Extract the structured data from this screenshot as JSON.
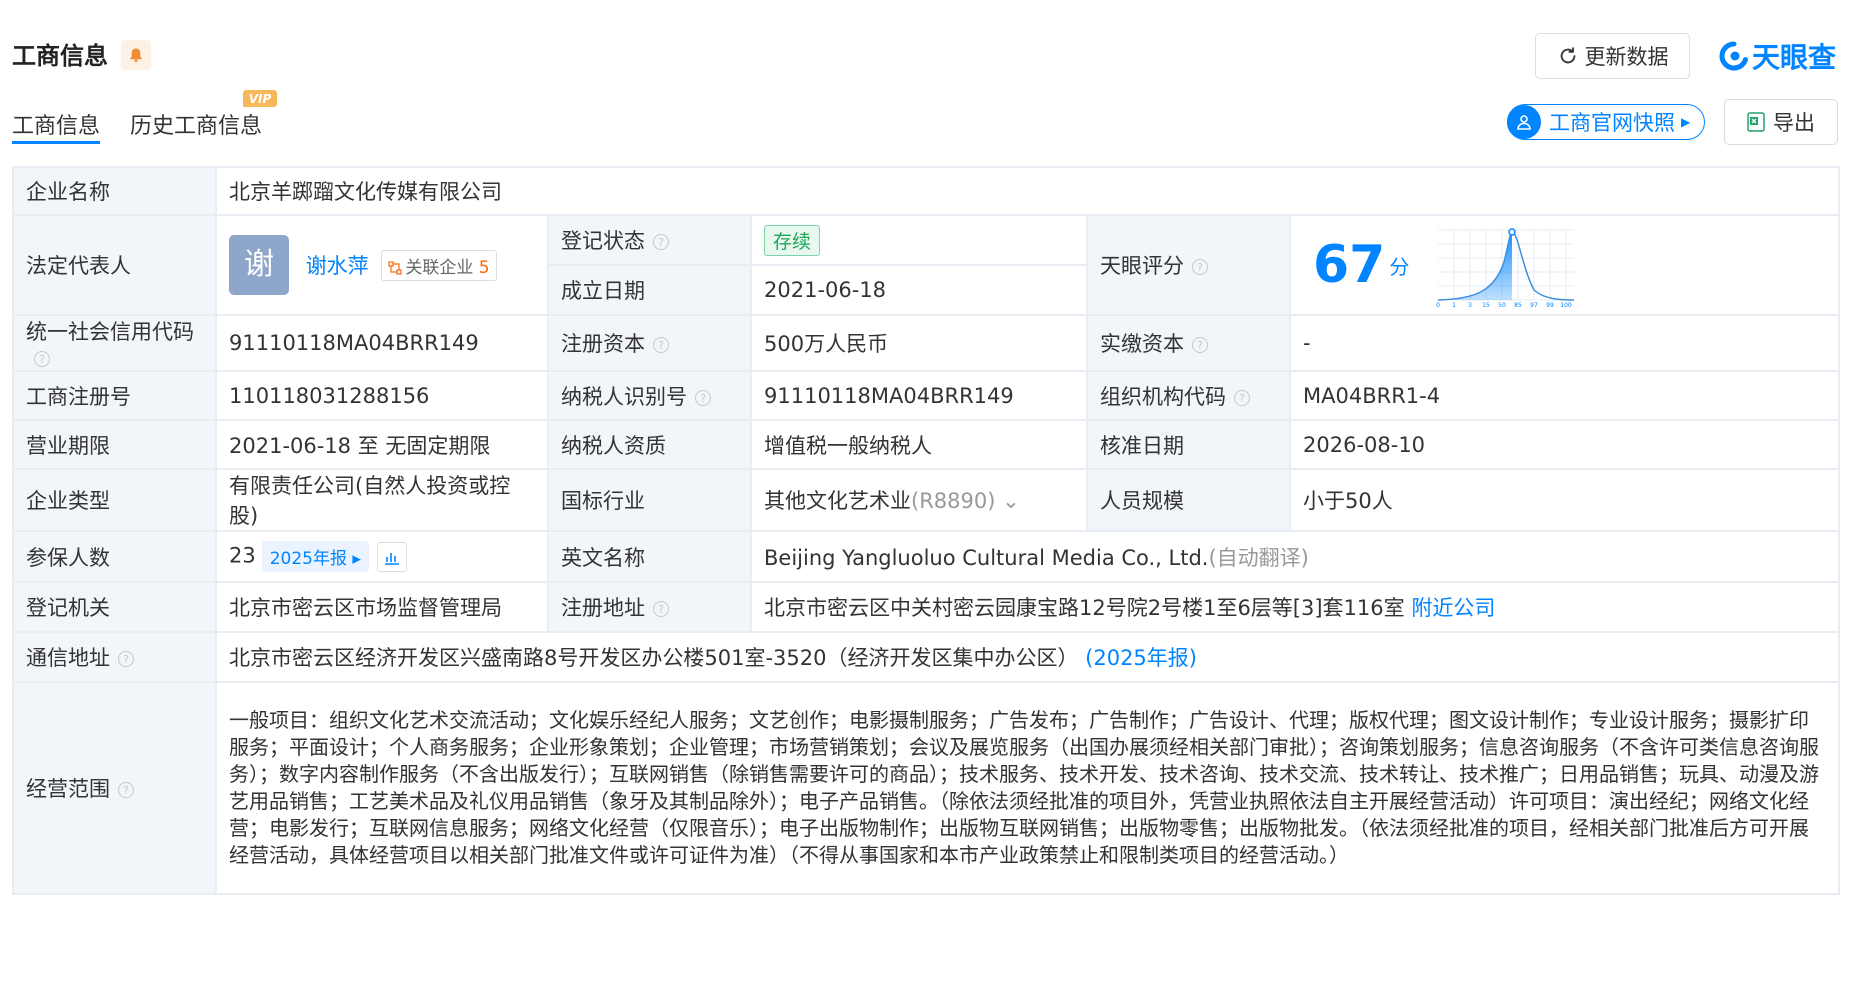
{
  "header": {
    "title": "工商信息",
    "refresh_label": "更新数据",
    "logo_text": "天眼查",
    "accent_color": "#0084ff"
  },
  "tabs": [
    {
      "label": "工商信息",
      "active": true
    },
    {
      "label": "历史工商信息",
      "badge": "VIP"
    }
  ],
  "actions": {
    "snapshot_label": "工商官网快照",
    "export_label": "导出"
  },
  "company": {
    "name_label": "企业名称",
    "name": "北京羊踯蹓文化传媒有限公司",
    "legal_rep_label": "法定代表人",
    "legal_rep_avatar": "谢",
    "legal_rep_name": "谢水萍",
    "related_label": "关联企业",
    "related_count": "5",
    "reg_status_label": "登记状态",
    "reg_status": "存续",
    "found_date_label": "成立日期",
    "found_date": "2021-06-18",
    "score_label": "天眼评分",
    "score": "67",
    "score_unit": "分",
    "credit_code_label": "统一社会信用代码",
    "credit_code": "91110118MA04BRR149",
    "reg_capital_label": "注册资本",
    "reg_capital": "500万人民币",
    "paid_capital_label": "实缴资本",
    "paid_capital": "-",
    "reg_no_label": "工商注册号",
    "reg_no": "110118031288156",
    "taxpayer_id_label": "纳税人识别号",
    "taxpayer_id": "91110118MA04BRR149",
    "org_code_label": "组织机构代码",
    "org_code": "MA04BRR1-4",
    "term_label": "营业期限",
    "term": "2021-06-18 至 无固定期限",
    "tax_qual_label": "纳税人资质",
    "tax_qual": "增值税一般纳税人",
    "approve_date_label": "核准日期",
    "approve_date": "2026-08-10",
    "type_label": "企业类型",
    "type": "有限责任公司(自然人投资或控股)",
    "industry_label": "国标行业",
    "industry": "其他文化艺术业",
    "industry_code": "(R8890)",
    "staff_label": "人员规模",
    "staff": "小于50人",
    "insured_label": "参保人数",
    "insured": "23",
    "insured_report": "2025年报",
    "en_name_label": "英文名称",
    "en_name": "Beijing Yangluoluo Cultural Media Co., Ltd.",
    "en_name_note": "(自动翻译)",
    "authority_label": "登记机关",
    "authority": "北京市密云区市场监督管理局",
    "reg_addr_label": "注册地址",
    "reg_addr": "北京市密云区中关村密云园康宝路12号院2号楼1至6层等[3]套116室",
    "nearby_label": "附近公司",
    "mail_addr_label": "通信地址",
    "mail_addr": "北京市密云区经济开发区兴盛南路8号开发区办公楼501室-3520（经济开发区集中办公区）",
    "mail_addr_report": "(2025年报)",
    "scope_label": "经营范围",
    "scope": "一般项目：组织文化艺术交流活动；文化娱乐经纪人服务；文艺创作；电影摄制服务；广告发布；广告制作；广告设计、代理；版权代理；图文设计制作；专业设计服务；摄影扩印服务；平面设计；个人商务服务；企业形象策划；企业管理；市场营销策划；会议及展览服务（出国办展须经相关部门审批）；咨询策划服务；信息咨询服务（不含许可类信息咨询服务）；数字内容制作服务（不含出版发行）；互联网销售（除销售需要许可的商品）；技术服务、技术开发、技术咨询、技术交流、技术转让、技术推广；日用品销售；玩具、动漫及游艺用品销售；工艺美术品及礼仪用品销售（象牙及其制品除外）；电子产品销售。（除依法须经批准的项目外，凭营业执照依法自主开展经营活动）许可项目：演出经纪；网络文化经营；电影发行；互联网信息服务；网络文化经营（仅限音乐）；电子出版物制作；出版物互联网销售；出版物零售；出版物批发。（依法须经批准的项目，经相关部门批准后方可开展经营活动，具体经营项目以相关部门批准文件或许可证件为准）（不得从事国家和本市产业政策禁止和限制类项目的经营活动。）"
  },
  "score_chart": {
    "ticks": [
      "0",
      "1",
      "3",
      "15",
      "50",
      "85",
      "97",
      "99",
      "100"
    ]
  }
}
